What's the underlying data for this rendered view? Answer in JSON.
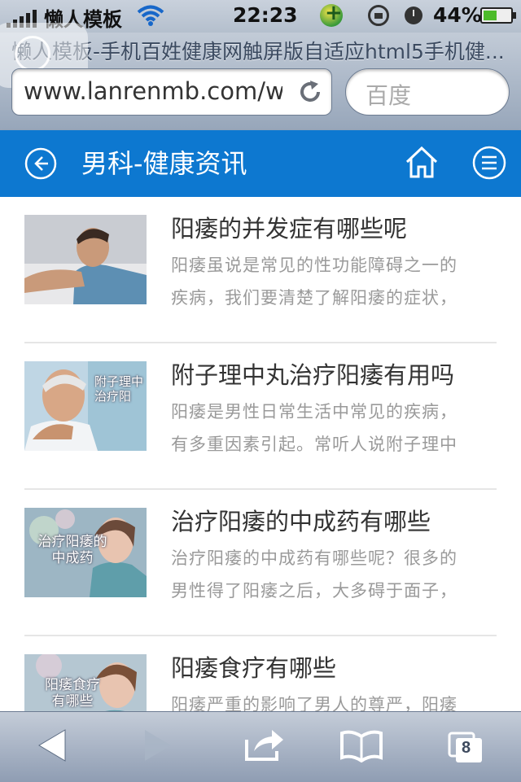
{
  "status_bar": {
    "carrier": "懒人模板",
    "time": "22:23",
    "battery_percent": "44%"
  },
  "browser": {
    "page_title": "懒人模板-手机百姓健康网触屏版自适应html5手机健...",
    "url": "www.lanrenmb.com/wap",
    "search_placeholder": "百度",
    "tab_count": "8"
  },
  "header": {
    "title": "男科-健康资讯"
  },
  "articles": [
    {
      "title": "阳痿的并发症有哪些呢",
      "desc_line1": "阳痿虽说是常见的性功能障碍之一的",
      "desc_line2": "疾病，我们要清楚了解阳痿的症状，",
      "thumb_text": ""
    },
    {
      "title": "附子理中丸治疗阳痿有用吗",
      "desc_line1": "阳痿是男性日常生活中常见的疾病，",
      "desc_line2": "有多重因素引起。常听人说附子理中",
      "thumb_text": "附子理中 治疗阳"
    },
    {
      "title": "治疗阳痿的中成药有哪些",
      "desc_line1": "治疗阳痿的中成药有哪些呢？很多的",
      "desc_line2": "男性得了阳痿之后，大多碍于面子，",
      "thumb_text": "治疗阳痿的 中成药"
    },
    {
      "title": "阳痿食疗有哪些",
      "desc_line1": "阳痿严重的影响了男人的尊严，阳痿",
      "desc_line2": "",
      "thumb_text": "阳痿食疗 有哪些"
    }
  ]
}
